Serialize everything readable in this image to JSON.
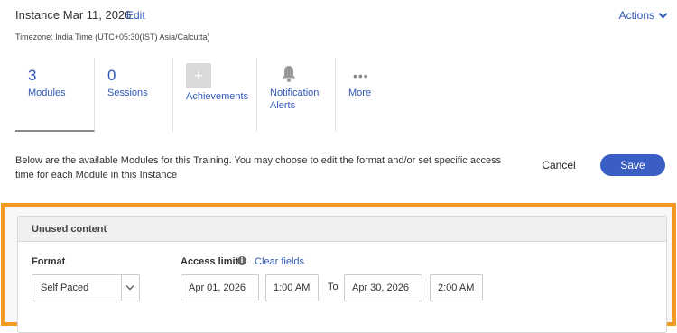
{
  "header": {
    "title": "Instance Mar 11, 2026",
    "edit_label": "Edit",
    "actions_label": "Actions",
    "timezone": "Timezone: India Time (UTC+05:30(IST) Asia/Calcutta)"
  },
  "tabs": [
    {
      "count": "3",
      "label": "Modules",
      "selected": true
    },
    {
      "count": "0",
      "label": "Sessions"
    },
    {
      "icon": "plus-icon",
      "label": "Achievements"
    },
    {
      "icon": "bell-icon",
      "label_line1": "Notification",
      "label_line2": "Alerts"
    },
    {
      "icon": "more-dots-icon",
      "label": "More"
    }
  ],
  "description": "Below are the available Modules for this Training. You may choose to edit the format and/or set specific access time for each Module in this Instance",
  "buttons": {
    "cancel": "Cancel",
    "save": "Save"
  },
  "unused": {
    "header": "Unused content",
    "format_label": "Format",
    "format_value": "Self Paced",
    "access_label": "Access limit",
    "clear_fields": "Clear fields",
    "start_date": "Apr 01, 2026",
    "start_time": "1:00 AM",
    "to_label": "To",
    "end_date": "Apr 30, 2026",
    "end_time": "2:00 AM"
  },
  "colors": {
    "accent": "#2f57b8",
    "save_button": "#3b5ec4",
    "highlight_border": "#f39a24"
  }
}
